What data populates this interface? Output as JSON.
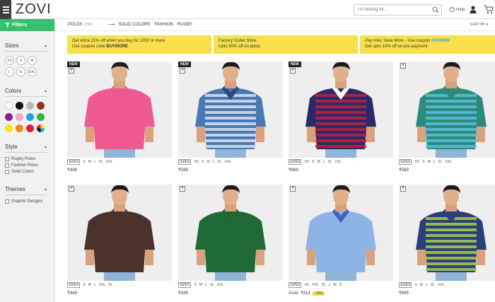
{
  "header": {
    "logo": "ZOVI",
    "search_placeholder": "I'm looking for...",
    "help_label": "Help"
  },
  "sidebar": {
    "filters_label": "Filters",
    "sizes_title": "Sizes",
    "sizes": [
      "XS",
      "S",
      "M",
      "L",
      "XL",
      "XXL"
    ],
    "colors_title": "Colors",
    "colors": [
      "#ffffff",
      "#111111",
      "#b9b9b9",
      "#8b3a1a",
      "#8a1aa0",
      "#f4a7c8",
      "#1fa3e0",
      "#38b24a",
      "#f6e21a",
      "#f08a1a",
      "#e61b3c",
      "multi"
    ],
    "style_title": "Style",
    "styles": [
      "Rugby Polos",
      "Fashion Polos",
      "Solid Colors"
    ],
    "themes_title": "Themes",
    "themes": [
      "Graphic Designs"
    ]
  },
  "crumbs": {
    "category": "POLOS",
    "count": "(198)",
    "subcats": [
      "SOLID COLORS",
      "FASHION",
      "RUGBY"
    ],
    "sort": "SORT BY"
  },
  "promos": [
    {
      "line1": "Get extra 21% off when you buy for 1200 or more",
      "line2_pre": "Use coupon code ",
      "line2_bold": "BUYMORE"
    },
    {
      "line1": "Factory Outlet Store",
      "line2_pre": "Upto 50% off on polos",
      "line2_bold": ""
    },
    {
      "line1_pre": "Pay now, Save More - Use coupon ",
      "line1_accent": "PAYNOW",
      "line2_pre": "Get upto 10% off on pre-payment",
      "line2_bold": ""
    }
  ],
  "products": [
    {
      "new": "NEW",
      "shirt": "#f05a93",
      "collar": "#f05a93",
      "stripes": "",
      "sizes_label": "SIZES",
      "sizes": [
        "S",
        "M",
        "L",
        "XL",
        "XXL"
      ],
      "price": "₹449",
      "old_price": "",
      "discount": ""
    },
    {
      "new": "NEW",
      "shirt": "#4a78b5",
      "collar": "#2c4a7a",
      "stripes": "#d9e3f0",
      "sizes_label": "SIZES",
      "sizes": [
        "XS",
        "S",
        "M",
        "L",
        "XL",
        "XXL"
      ],
      "price": "₹599",
      "old_price": "",
      "discount": ""
    },
    {
      "new": "NEW",
      "shirt": "#2a2a6a",
      "collar": "#ffffff",
      "stripes": "#c0223a",
      "sizes_label": "SIZES",
      "sizes": [
        "XS",
        "S",
        "M",
        "L",
        "XL",
        "XXL"
      ],
      "price": "₹699",
      "old_price": "",
      "discount": ""
    },
    {
      "new": "",
      "shirt": "#2d8b7a",
      "collar": "#2d8b7a",
      "stripes": "#5bc0e0",
      "sizes_label": "SIZES",
      "sizes": [
        "XS",
        "S",
        "M",
        "L",
        "XL",
        "XXL"
      ],
      "price": "₹599",
      "old_price": "",
      "discount": ""
    },
    {
      "new": "",
      "shirt": "#4a3328",
      "collar": "#4a3328",
      "stripes": "",
      "sizes_label": "SIZES",
      "sizes": [
        "S",
        "M",
        "L",
        "XXL",
        "XL"
      ],
      "price": "₹449",
      "old_price": "",
      "discount": ""
    },
    {
      "new": "",
      "shirt": "#1f6a35",
      "collar": "#1f6a35",
      "stripes": "",
      "sizes_label": "SIZES",
      "sizes": [
        "S",
        "M",
        "L",
        "XL",
        "XXL"
      ],
      "price": "₹449",
      "old_price": "",
      "discount": ""
    },
    {
      "new": "",
      "shirt": "#8eb4e6",
      "collar": "#3a64c0",
      "stripes": "",
      "sizes_label": "SIZES",
      "sizes": [
        "XS",
        "XXL",
        "XL",
        "L",
        "M",
        "S"
      ],
      "price": "₹314",
      "old_price": "₹449",
      "discount": "- 30%"
    },
    {
      "new": "",
      "shirt": "#2c3f7a",
      "collar": "#2c3f7a",
      "stripes": "#a8d04a",
      "sizes_label": "SIZES",
      "sizes": [
        "S",
        "M",
        "L",
        "XL",
        "XXL"
      ],
      "price": "₹699",
      "old_price": "",
      "discount": ""
    }
  ]
}
